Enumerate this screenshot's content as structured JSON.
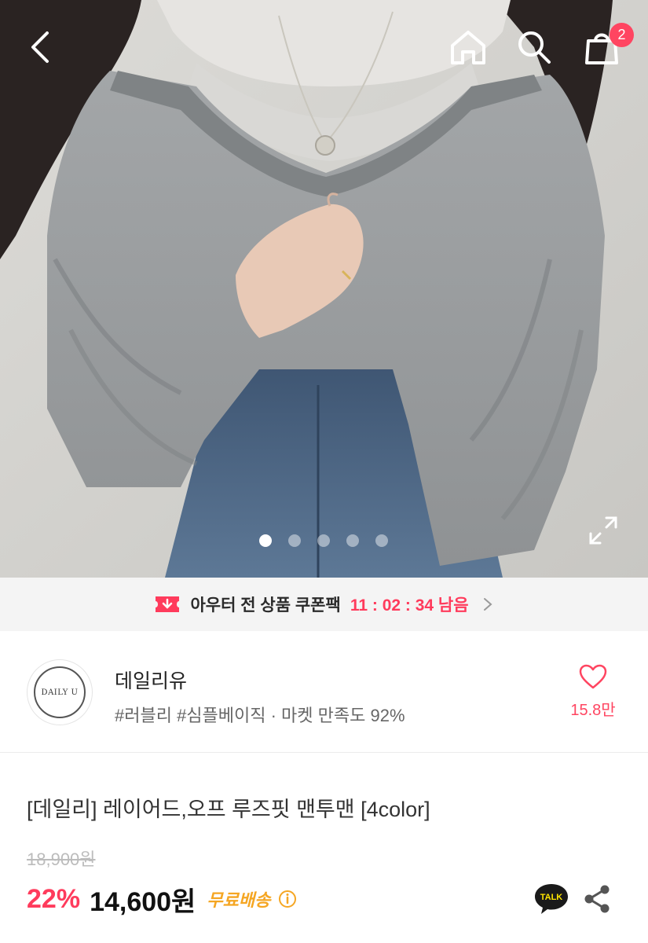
{
  "header": {
    "cart_count": "2"
  },
  "gallery": {
    "slide_count": 5,
    "active_index": 0
  },
  "coupon": {
    "text": "아우터 전 상품 쿠폰팩",
    "timer": "11 : 02 : 34 남음"
  },
  "store": {
    "logo_text": "DAILY U",
    "name": "데일리유",
    "tags": "#러블리 #심플베이직 · 마켓 만족도 92%",
    "likes": "15.8만"
  },
  "product": {
    "title": "[데일리] 레이어드,오프 루즈핏 맨투맨 [4color]",
    "original_price": "18,900원",
    "discount": "22%",
    "price": "14,600원",
    "shipping": "무료배송"
  },
  "actions": {
    "talk_label": "TALK"
  },
  "colors": {
    "accent": "#ff4561",
    "discount": "#ff3b5c",
    "shipping": "#f5a623",
    "talk_bubble": "#1a1a1a",
    "talk_yellow": "#fee500"
  }
}
